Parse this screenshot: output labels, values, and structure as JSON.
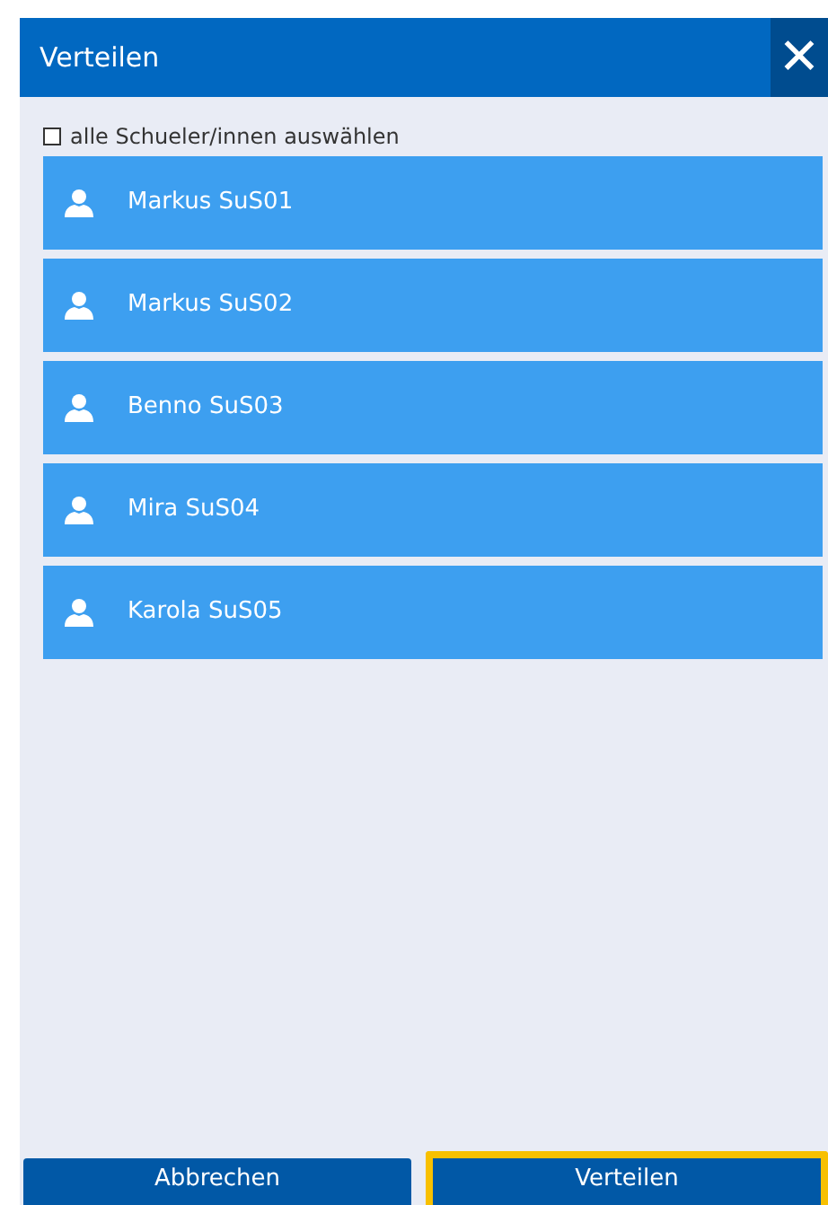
{
  "dialog": {
    "title": "Verteilen",
    "close_label": "✕"
  },
  "select_all": {
    "label": "alle Schueler/innen auswählen",
    "checked": false
  },
  "students": [
    {
      "name": "Markus SuS01",
      "selected": false
    },
    {
      "name": "Markus SuS02",
      "selected": false
    },
    {
      "name": "Benno SuS03",
      "selected": false
    },
    {
      "name": "Mira SuS04",
      "selected": false
    },
    {
      "name": "Karola SuS05",
      "selected": false
    }
  ],
  "buttons": [
    {
      "label": "Abbrechen",
      "focused": false
    },
    {
      "label": "Verteilen",
      "focused": true
    }
  ]
}
